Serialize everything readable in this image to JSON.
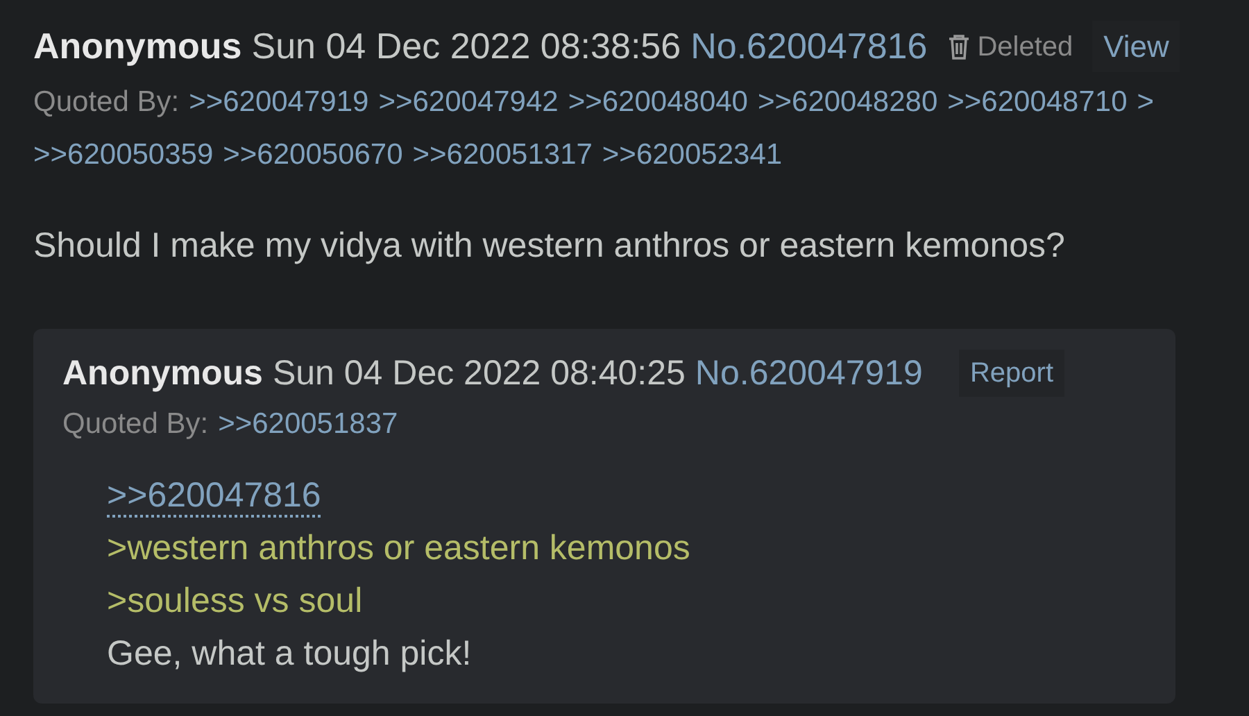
{
  "post": {
    "name": "Anonymous",
    "date": "Sun 04 Dec 2022 08:38:56",
    "number": "No.620047816",
    "deleted_label": "Deleted",
    "action": "View",
    "quoted_by": {
      "label": "Quoted By:",
      "lines": [
        [
          ">>620047919",
          ">>620047942",
          ">>620048040",
          ">>620048280",
          ">>620048710",
          ">"
        ],
        [
          ">>620050359",
          ">>620050670",
          ">>620051317",
          ">>620052341"
        ]
      ]
    },
    "body": "Should I make my vidya with western anthros or eastern kemonos?"
  },
  "reply": {
    "name": "Anonymous",
    "date": "Sun 04 Dec 2022 08:40:25",
    "number": "No.620047919",
    "action": "Report",
    "quoted_by": {
      "label": "Quoted By:",
      "lines": [
        [
          ">>620051837"
        ]
      ]
    },
    "body": [
      {
        "kind": "quotelink",
        "text": ">>620047816"
      },
      {
        "kind": "greentext",
        "text": ">western anthros or eastern kemonos"
      },
      {
        "kind": "greentext",
        "text": ">souless vs soul"
      },
      {
        "kind": "text",
        "text": "Gee, what a tough pick!"
      }
    ]
  }
}
